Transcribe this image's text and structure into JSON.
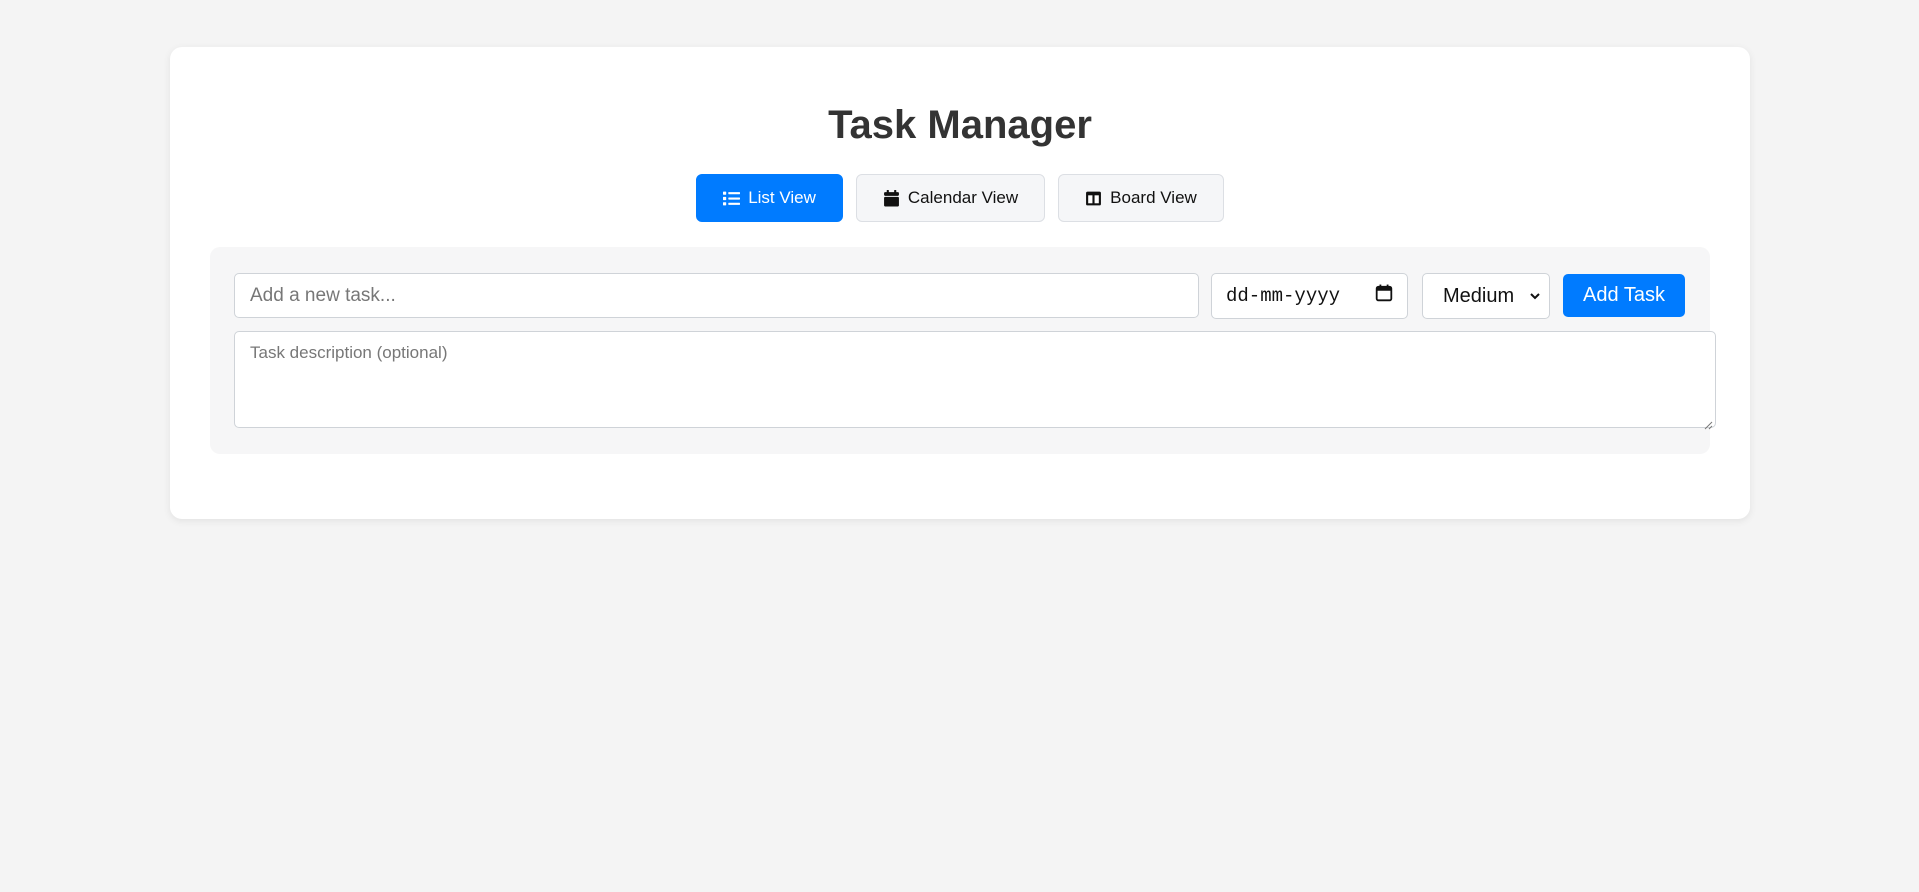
{
  "app": {
    "title": "Task Manager"
  },
  "views": {
    "tabs": [
      {
        "label": "List View",
        "icon": "list-icon",
        "active": true
      },
      {
        "label": "Calendar View",
        "icon": "calendar-icon",
        "active": false
      },
      {
        "label": "Board View",
        "icon": "board-icon",
        "active": false
      }
    ]
  },
  "form": {
    "task_placeholder": "Add a new task...",
    "date_placeholder": "dd-mm-yyyy",
    "priority_selected": "Medium",
    "add_label": "Add Task",
    "description_placeholder": "Task description (optional)"
  },
  "colors": {
    "accent": "#007bff",
    "background": "#f4f4f4",
    "title": "#333333"
  }
}
